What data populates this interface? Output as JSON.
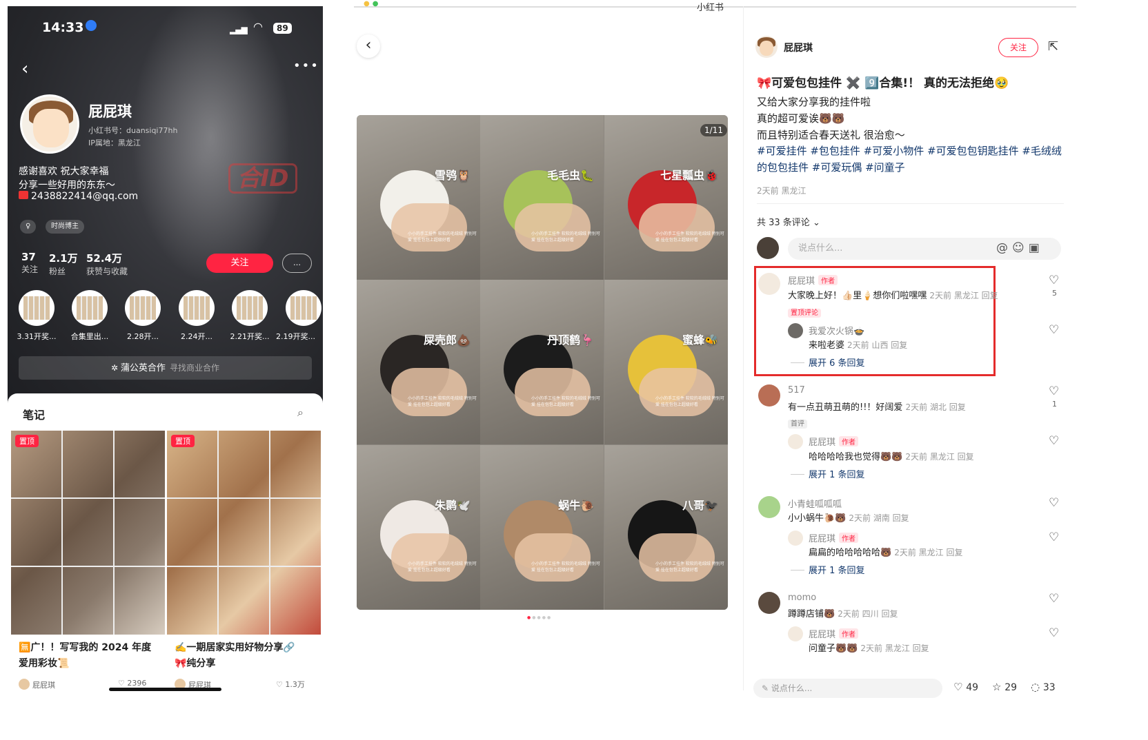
{
  "phone": {
    "status": {
      "time": "14:33",
      "battery": "89"
    },
    "profile": {
      "name": "屁屁琪",
      "red_id": "小红书号：duansiqi77hh",
      "ip": "IP属地：黑龙江",
      "bio_1": "感谢喜欢 祝大家幸福",
      "bio_2": "分享一些好用的东东～",
      "qq": "2438822414@qq.com",
      "watermark": "合ID",
      "tag_gender": "♀",
      "tag_role": "时尚博主",
      "stats": [
        {
          "num": "37",
          "label": "关注"
        },
        {
          "num": "2.1万",
          "label": "粉丝"
        },
        {
          "num": "52.4万",
          "label": "获赞与收藏"
        }
      ],
      "follow": "关注",
      "collections": [
        "3.31开奖...",
        "合集里出...",
        "2.28开...",
        "2.24开...",
        "2.21开奖...",
        "2.19开奖..."
      ],
      "pugong": "蒲公英合作",
      "pugong_sub": "寻找商业合作"
    },
    "notes": {
      "tab": "笔记",
      "cards": [
        {
          "pin": "置顶",
          "title_1": "🈚广！！写写我的 2024 年度",
          "title_2": "爱用彩妆📜",
          "author": "屁屁琪",
          "likes": "2396"
        },
        {
          "pin": "置顶",
          "title_1": "✍️一期居家实用好物分享🔗",
          "title_2": "🎀纯分享",
          "author": "屁屁琪",
          "likes": "1.3万"
        }
      ]
    }
  },
  "middle": {
    "title": "小红书",
    "counter": "1/11",
    "tiles": [
      {
        "label": "雪鸮🦉",
        "color": "#f2f0ea"
      },
      {
        "label": "毛毛虫🐛",
        "color": "#a7c25a"
      },
      {
        "label": "七星瓢虫🐞",
        "color": "#c8262a"
      },
      {
        "label": "屎壳郎💩",
        "color": "#2a2624"
      },
      {
        "label": "丹顶鹤🦩",
        "color": "#1c1c1c"
      },
      {
        "label": "蜜蜂🐝",
        "color": "#e6c13a"
      },
      {
        "label": "朱鹮🕊️",
        "color": "#efe9e4"
      },
      {
        "label": "蜗牛🐌",
        "color": "#b08a68"
      },
      {
        "label": "八哥🐦‍⬛",
        "color": "#161616"
      }
    ],
    "tile_note": "小小的手工挂件 软软的毛绒绒 特别可爱 挂在包包上超级好看"
  },
  "right": {
    "author": "屁屁琪",
    "follow": "关注",
    "title": "🎀可爱包包挂件 ✖️ 9️⃣合集!！ 真的无法拒绝🥹",
    "lines": [
      "又给大家分享我的挂件啦",
      "真的超可爱诶🐻🐻",
      "而且特别适合春天送礼 很治愈～"
    ],
    "tags_text": "#可爱挂件 #包包挂件 #可爱小物件 #可爱包包钥匙挂件 #毛绒绒的包包挂件 #可爱玩偶 #问童子",
    "meta": "2天前 黑龙江",
    "comment_count": "共 33 条评论",
    "input_placeholder": "说点什么...",
    "comments": [
      {
        "name": "屁屁琪",
        "author_tag": "作者",
        "text": "大家晚上好！👍🏻里🍦想你们啦嘿嘿",
        "meta": "2天前 黑龙江 回复",
        "pin_label": "置顶评论",
        "likes": "5",
        "reply": {
          "name": "我爱次火锅🍲",
          "text": "来啦老婆",
          "meta": "2天前 山西 回复"
        },
        "expand": "展开 6 条回复"
      },
      {
        "name": "517",
        "text": "有一点丑萌丑萌的!!！好阔爱",
        "meta": "2天前 湖北 回复",
        "first": "首评",
        "likes": "1",
        "reply": {
          "name": "屁屁琪",
          "author_tag": "作者",
          "text": "哈哈哈哈我也觉得🐻🐻",
          "meta": "2天前 黑龙江 回复"
        },
        "expand": "展开 1 条回复"
      },
      {
        "name": "小青蛙呱呱呱",
        "text": "小小蜗牛🐌🐻",
        "meta": "2天前 湖南 回复",
        "reply": {
          "name": "屁屁琪",
          "author_tag": "作者",
          "text": "扁扁的哈哈哈哈哈🐻",
          "meta": "2天前 黑龙江 回复"
        },
        "expand": "展开 1 条回复"
      },
      {
        "name": "momo",
        "text": "蹲蹲店铺🐻",
        "meta": "2天前 四川 回复",
        "reply": {
          "name": "屁屁琪",
          "author_tag": "作者",
          "text": "问童子🐻🐻",
          "meta": "2天前 黑龙江 回复"
        }
      }
    ],
    "footer": {
      "placeholder": "说点什么...",
      "likes": "49",
      "stars": "29",
      "comments": "33"
    }
  }
}
